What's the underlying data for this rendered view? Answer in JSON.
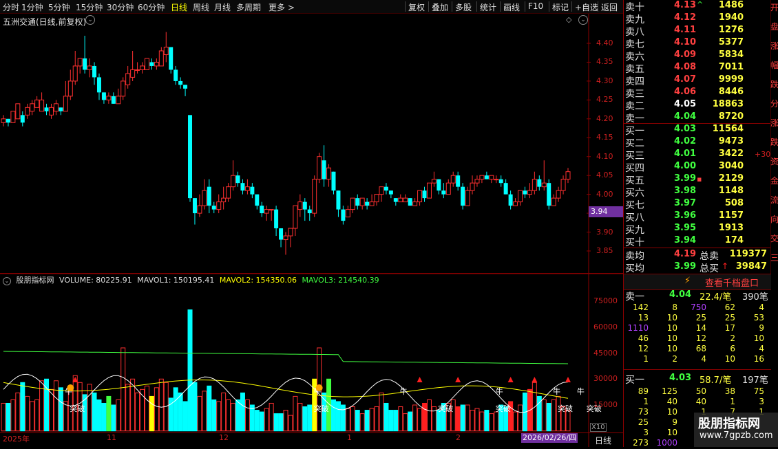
{
  "toolbar": {
    "left_tabs": [
      {
        "label": "分时",
        "x": 4
      },
      {
        "label": "1分钟",
        "x": 31
      },
      {
        "label": "5分钟",
        "x": 70
      },
      {
        "label": "15分钟",
        "x": 110
      },
      {
        "label": "30分钟",
        "x": 155
      },
      {
        "label": "60分钟",
        "x": 200
      },
      {
        "label": "日线",
        "x": 248,
        "active": true
      },
      {
        "label": "周线",
        "x": 280
      },
      {
        "label": "月线",
        "x": 311
      },
      {
        "label": "多周期",
        "x": 343
      },
      {
        "label": "更多 >",
        "x": 390
      }
    ],
    "right_buttons": [
      {
        "label": "复权",
        "x": 593
      },
      {
        "label": "叠加",
        "x": 627
      },
      {
        "label": "多股",
        "x": 661
      },
      {
        "label": "统计",
        "x": 697
      },
      {
        "label": "画线",
        "x": 731
      },
      {
        "label": "F10",
        "x": 767
      },
      {
        "label": "标记",
        "x": 802
      },
      {
        "label": "+自选",
        "x": 835
      },
      {
        "label": "返回",
        "x": 873
      }
    ]
  },
  "main_chart": {
    "title": "五洲交通(日线,前复权)",
    "y_ticks": [
      "4.40",
      "4.35",
      "4.30",
      "4.25",
      "4.20",
      "4.15",
      "4.10",
      "4.05",
      "4.00",
      "3.95",
      "3.90",
      "3.85"
    ],
    "current_price": "3.94"
  },
  "volume_chart": {
    "legend": [
      {
        "text": "股朋指标网",
        "color": "#e0e0e0"
      },
      {
        "text": "VOLUME: 80225.91",
        "color": "#e0e0e0"
      },
      {
        "text": "MAVOL1: 150195.41",
        "color": "#e0e0e0"
      },
      {
        "text": "MAVOL2: 154350.06",
        "color": "#ffff00"
      },
      {
        "text": "MAVOL3: 214540.39",
        "color": "#40ff40"
      }
    ],
    "y_ticks": [
      "75000",
      "60000",
      "45000",
      "30000",
      "15000"
    ],
    "x10": "X10",
    "signals": {
      "breakout": "突破",
      "bull": "牛"
    }
  },
  "date_axis": {
    "labels": [
      {
        "text": "2025年",
        "x": 4
      },
      {
        "text": "11",
        "x": 155
      },
      {
        "text": "12",
        "x": 318
      },
      {
        "text": "1",
        "x": 504
      },
      {
        "text": "2",
        "x": 662
      }
    ],
    "current_date": "2026/02/26/四",
    "period": "日线"
  },
  "order_book": {
    "asks": [
      {
        "label": "卖十",
        "price": "4.13",
        "qty": "1486",
        "mark": "^",
        "price_color": "#ff4040"
      },
      {
        "label": "卖九",
        "price": "4.12",
        "qty": "1940",
        "price_color": "#ff4040"
      },
      {
        "label": "卖八",
        "price": "4.11",
        "qty": "1276",
        "price_color": "#ff4040"
      },
      {
        "label": "卖七",
        "price": "4.10",
        "qty": "5377",
        "price_color": "#ff4040"
      },
      {
        "label": "卖六",
        "price": "4.09",
        "qty": "5834",
        "price_color": "#ff4040"
      },
      {
        "label": "卖五",
        "price": "4.08",
        "qty": "7011",
        "price_color": "#ff4040"
      },
      {
        "label": "卖四",
        "price": "4.07",
        "qty": "9999",
        "price_color": "#ff4040"
      },
      {
        "label": "卖三",
        "price": "4.06",
        "qty": "8446",
        "price_color": "#ff4040"
      },
      {
        "label": "卖二",
        "price": "4.05",
        "qty": "18863",
        "price_color": "#ffffff"
      },
      {
        "label": "卖一",
        "price": "4.04",
        "qty": "8720",
        "price_color": "#40ff40"
      }
    ],
    "bids": [
      {
        "label": "买一",
        "price": "4.03",
        "qty": "11564",
        "price_color": "#40ff40"
      },
      {
        "label": "买二",
        "price": "4.02",
        "qty": "9473",
        "price_color": "#40ff40"
      },
      {
        "label": "买三",
        "price": "4.01",
        "qty": "3422",
        "change": "+30",
        "price_color": "#40ff40"
      },
      {
        "label": "买四",
        "price": "4.00",
        "qty": "3040",
        "price_color": "#40ff40"
      },
      {
        "label": "买五",
        "price": "3.99",
        "qty": "2129",
        "mark": "▪",
        "price_color": "#40ff40"
      },
      {
        "label": "买六",
        "price": "3.98",
        "qty": "1148",
        "price_color": "#40ff40"
      },
      {
        "label": "买七",
        "price": "3.97",
        "qty": "508",
        "price_color": "#40ff40"
      },
      {
        "label": "买八",
        "price": "3.96",
        "qty": "1157",
        "price_color": "#40ff40"
      },
      {
        "label": "买九",
        "price": "3.95",
        "qty": "1913",
        "price_color": "#40ff40"
      },
      {
        "label": "买十",
        "price": "3.94",
        "qty": "174",
        "price_color": "#40ff40"
      }
    ],
    "avg_sell_label": "卖均",
    "avg_sell_price": "4.19",
    "total_sell_label": "总卖",
    "total_sell": "119377",
    "avg_buy_label": "买均",
    "avg_buy_price": "3.99",
    "total_buy_label": "总买",
    "total_buy": "39847",
    "thousand_button": "查看千档盘口"
  },
  "queue": {
    "sell_label": "卖一",
    "sell_price": "4.04",
    "sell_avg": "22.4/笔",
    "sell_count": "390笔",
    "sell_rows": [
      [
        "142",
        "8",
        "750",
        "62",
        "4"
      ],
      [
        "13",
        "10",
        "25",
        "25",
        "53"
      ],
      [
        "1110",
        "10",
        "14",
        "17",
        "9"
      ],
      [
        "46",
        "10",
        "12",
        "2",
        "10"
      ],
      [
        "12",
        "10",
        "68",
        "6",
        "4"
      ],
      [
        "1",
        "2",
        "4",
        "10",
        "16"
      ]
    ],
    "buy_label": "买一",
    "buy_price": "4.03",
    "buy_avg": "58.7/笔",
    "buy_count": "197笔",
    "buy_rows": [
      [
        "89",
        "125",
        "50",
        "38",
        "75"
      ],
      [
        "1",
        "40",
        "40",
        "1",
        "3"
      ],
      [
        "73",
        "10",
        "1",
        "7",
        "1"
      ],
      [
        "25",
        "9",
        "",
        "",
        ""
      ],
      [
        "3",
        "10",
        "",
        "",
        ""
      ],
      [
        "273",
        "1000",
        "",
        "",
        ""
      ]
    ]
  },
  "sidebar": {
    "chars": [
      "开",
      "盘",
      "涨",
      "幅",
      "跌",
      "分",
      "涨",
      "跌",
      "资",
      "金",
      "流",
      "向",
      "交",
      "三"
    ]
  },
  "brand": {
    "name": "股朋指标网",
    "url": "www.7gpzb.com"
  },
  "colors": {
    "up": "#ff3030",
    "down": "#00ffff",
    "ma1": "#ffffff",
    "ma2": "#ffff00",
    "ma3": "#40ff40",
    "grid": "#8b0000"
  }
}
